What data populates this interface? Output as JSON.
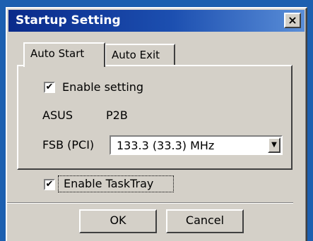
{
  "window": {
    "title": "Startup Setting",
    "close_glyph": "×"
  },
  "tabs": [
    {
      "label": "Auto Start",
      "active": true
    },
    {
      "label": "Auto Exit",
      "active": false
    }
  ],
  "auto_start": {
    "enable_setting": {
      "label": "Enable setting",
      "checked": true
    },
    "board_vendor": "ASUS",
    "board_model": "P2B",
    "fsb_label": "FSB (PCI)",
    "fsb_value": "133.3 (33.3) MHz"
  },
  "tasktray": {
    "label": "Enable TaskTray",
    "checked": true
  },
  "buttons": {
    "ok": "OK",
    "cancel": "Cancel"
  },
  "icons": {
    "close": "close-icon",
    "check": "check-icon",
    "dropdown": "chevron-down-icon"
  },
  "colors": {
    "title_bar_start": "#0a2a8a",
    "title_bar_end": "#5a8ed8",
    "face": "#d4d0c8",
    "background": "#1c5fb0"
  }
}
